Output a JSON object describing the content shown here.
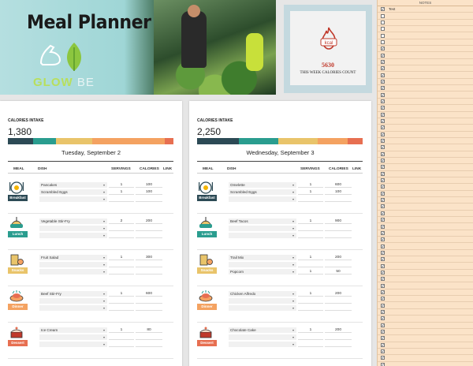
{
  "banner": {
    "title": "Meal Planner",
    "logo_text_1": "GLOW",
    "logo_text_2": " BE"
  },
  "weekly": {
    "icon_label": "kcal",
    "value": "5630",
    "label": "THIS WEEK CALORIES COUNT"
  },
  "notes": {
    "title": "NOTES",
    "rows": [
      {
        "checked": true,
        "text": "Test"
      },
      {
        "checked": false,
        "text": ""
      },
      {
        "checked": false,
        "text": ""
      },
      {
        "checked": false,
        "text": ""
      },
      {
        "checked": false,
        "text": ""
      },
      {
        "checked": false,
        "text": ""
      },
      {
        "checked": true,
        "text": ""
      },
      {
        "checked": true,
        "text": ""
      },
      {
        "checked": true,
        "text": ""
      },
      {
        "checked": true,
        "text": ""
      },
      {
        "checked": true,
        "text": ""
      },
      {
        "checked": true,
        "text": ""
      },
      {
        "checked": true,
        "text": ""
      },
      {
        "checked": true,
        "text": ""
      },
      {
        "checked": true,
        "text": ""
      },
      {
        "checked": true,
        "text": ""
      },
      {
        "checked": true,
        "text": ""
      },
      {
        "checked": true,
        "text": ""
      },
      {
        "checked": true,
        "text": ""
      },
      {
        "checked": true,
        "text": ""
      },
      {
        "checked": true,
        "text": ""
      },
      {
        "checked": true,
        "text": ""
      },
      {
        "checked": true,
        "text": ""
      },
      {
        "checked": true,
        "text": ""
      },
      {
        "checked": true,
        "text": ""
      },
      {
        "checked": true,
        "text": ""
      },
      {
        "checked": true,
        "text": ""
      },
      {
        "checked": true,
        "text": ""
      },
      {
        "checked": true,
        "text": ""
      },
      {
        "checked": true,
        "text": ""
      },
      {
        "checked": true,
        "text": ""
      },
      {
        "checked": true,
        "text": ""
      },
      {
        "checked": true,
        "text": ""
      },
      {
        "checked": true,
        "text": ""
      },
      {
        "checked": true,
        "text": ""
      },
      {
        "checked": true,
        "text": ""
      },
      {
        "checked": true,
        "text": ""
      },
      {
        "checked": true,
        "text": ""
      },
      {
        "checked": true,
        "text": ""
      },
      {
        "checked": true,
        "text": ""
      },
      {
        "checked": true,
        "text": ""
      },
      {
        "checked": true,
        "text": ""
      },
      {
        "checked": true,
        "text": ""
      },
      {
        "checked": true,
        "text": ""
      },
      {
        "checked": true,
        "text": ""
      },
      {
        "checked": true,
        "text": ""
      },
      {
        "checked": true,
        "text": ""
      },
      {
        "checked": true,
        "text": ""
      },
      {
        "checked": true,
        "text": ""
      },
      {
        "checked": true,
        "text": ""
      },
      {
        "checked": true,
        "text": ""
      },
      {
        "checked": true,
        "text": ""
      },
      {
        "checked": true,
        "text": ""
      },
      {
        "checked": true,
        "text": ""
      },
      {
        "checked": true,
        "text": ""
      }
    ]
  },
  "headers": {
    "intake": "CALORIES INTAKE",
    "meal": "MEAL",
    "dish": "DISH",
    "servings": "SERVINGS",
    "calories": "CALORIES",
    "link": "LINK"
  },
  "meal_colors": {
    "Breakfast": "#2c4a55",
    "Lunch": "#2a9d8f",
    "Snacks": "#e9c46a",
    "Dinner": "#f4a261",
    "Dessert": "#e76f51"
  },
  "days": [
    {
      "date": "Tuesday, September 2",
      "intake": "1,380",
      "bar_fractions": [
        0.15,
        0.14,
        0.22,
        0.44,
        0.05
      ],
      "meals": [
        {
          "label": "Breakfast",
          "rows": [
            {
              "dish": "Pancakes",
              "servings": "1",
              "calories": "100"
            },
            {
              "dish": "Scrambled Eggs",
              "servings": "1",
              "calories": "100"
            },
            {
              "dish": "",
              "servings": "",
              "calories": ""
            }
          ]
        },
        {
          "label": "Lunch",
          "rows": [
            {
              "dish": "Vegetable Stir-Fry",
              "servings": "2",
              "calories": "200"
            },
            {
              "dish": "",
              "servings": "",
              "calories": ""
            },
            {
              "dish": "",
              "servings": "",
              "calories": ""
            }
          ]
        },
        {
          "label": "Snacks",
          "rows": [
            {
              "dish": "Fruit Salad",
              "servings": "1",
              "calories": "300"
            },
            {
              "dish": "",
              "servings": "",
              "calories": ""
            },
            {
              "dish": "",
              "servings": "",
              "calories": ""
            }
          ]
        },
        {
          "label": "Dinner",
          "rows": [
            {
              "dish": "Beef Stir-Fry",
              "servings": "1",
              "calories": "600"
            },
            {
              "dish": "",
              "servings": "",
              "calories": ""
            },
            {
              "dish": "",
              "servings": "",
              "calories": ""
            }
          ]
        },
        {
          "label": "Dessert",
          "rows": [
            {
              "dish": "Ice Cream",
              "servings": "1",
              "calories": "80"
            },
            {
              "dish": "",
              "servings": "",
              "calories": ""
            },
            {
              "dish": "",
              "servings": "",
              "calories": ""
            }
          ]
        }
      ]
    },
    {
      "date": "Wednesday, September 3",
      "intake": "2,250",
      "bar_fractions": [
        0.25,
        0.24,
        0.24,
        0.18,
        0.09
      ],
      "meals": [
        {
          "label": "Breakfast",
          "rows": [
            {
              "dish": "Omelette",
              "servings": "1",
              "calories": "600"
            },
            {
              "dish": "Scrambled Eggs",
              "servings": "1",
              "calories": "100"
            },
            {
              "dish": "",
              "servings": "",
              "calories": ""
            }
          ]
        },
        {
          "label": "Lunch",
          "rows": [
            {
              "dish": "Beef Tacos",
              "servings": "1",
              "calories": "900"
            },
            {
              "dish": "",
              "servings": "",
              "calories": ""
            },
            {
              "dish": "",
              "servings": "",
              "calories": ""
            }
          ]
        },
        {
          "label": "Snacks",
          "rows": [
            {
              "dish": "Trail Mix",
              "servings": "1",
              "calories": "200"
            },
            {
              "dish": "",
              "servings": "",
              "calories": ""
            },
            {
              "dish": "Popcorn",
              "servings": "1",
              "calories": "50"
            }
          ]
        },
        {
          "label": "Dinner",
          "rows": [
            {
              "dish": "Chicken Alfredo",
              "servings": "1",
              "calories": "200"
            },
            {
              "dish": "",
              "servings": "",
              "calories": ""
            },
            {
              "dish": "",
              "servings": "",
              "calories": ""
            }
          ]
        },
        {
          "label": "Dessert",
          "rows": [
            {
              "dish": "Chocolate Cake",
              "servings": "1",
              "calories": "200"
            },
            {
              "dish": "",
              "servings": "",
              "calories": ""
            },
            {
              "dish": "",
              "servings": "",
              "calories": ""
            }
          ]
        }
      ]
    }
  ]
}
